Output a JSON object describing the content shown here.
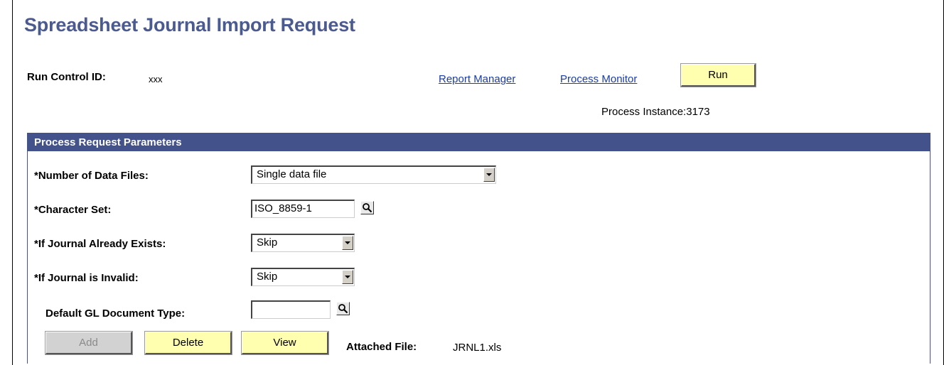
{
  "page": {
    "title": "Spreadsheet Journal Import Request"
  },
  "run_control": {
    "label": "Run Control ID:",
    "value": "xxx"
  },
  "links": {
    "report_manager": "Report Manager",
    "process_monitor": "Process Monitor"
  },
  "run_button": "Run",
  "process_instance": "Process Instance:3173",
  "panel": {
    "title": "Process Request Parameters",
    "number_of_files": {
      "label": "*Number of Data Files:",
      "value": "Single data file"
    },
    "character_set": {
      "label": "*Character Set:",
      "value": "ISO_8859-1"
    },
    "journal_exists": {
      "label": "*If Journal Already Exists:",
      "value": "Skip"
    },
    "journal_invalid": {
      "label": "*If Journal is Invalid:",
      "value": "Skip"
    },
    "doc_type": {
      "label": "Default GL Document Type:",
      "value": ""
    },
    "buttons": {
      "add": "Add",
      "delete": "Delete",
      "view": "View"
    },
    "attached_file": {
      "label": "Attached File:",
      "value": "JRNL1.xls"
    }
  },
  "colors": {
    "title": "#4b5a8f",
    "header_bar": "#43528a",
    "link": "#1a3ca8",
    "button": "#ffffaf",
    "button_disabled": "#d2d2d2"
  }
}
